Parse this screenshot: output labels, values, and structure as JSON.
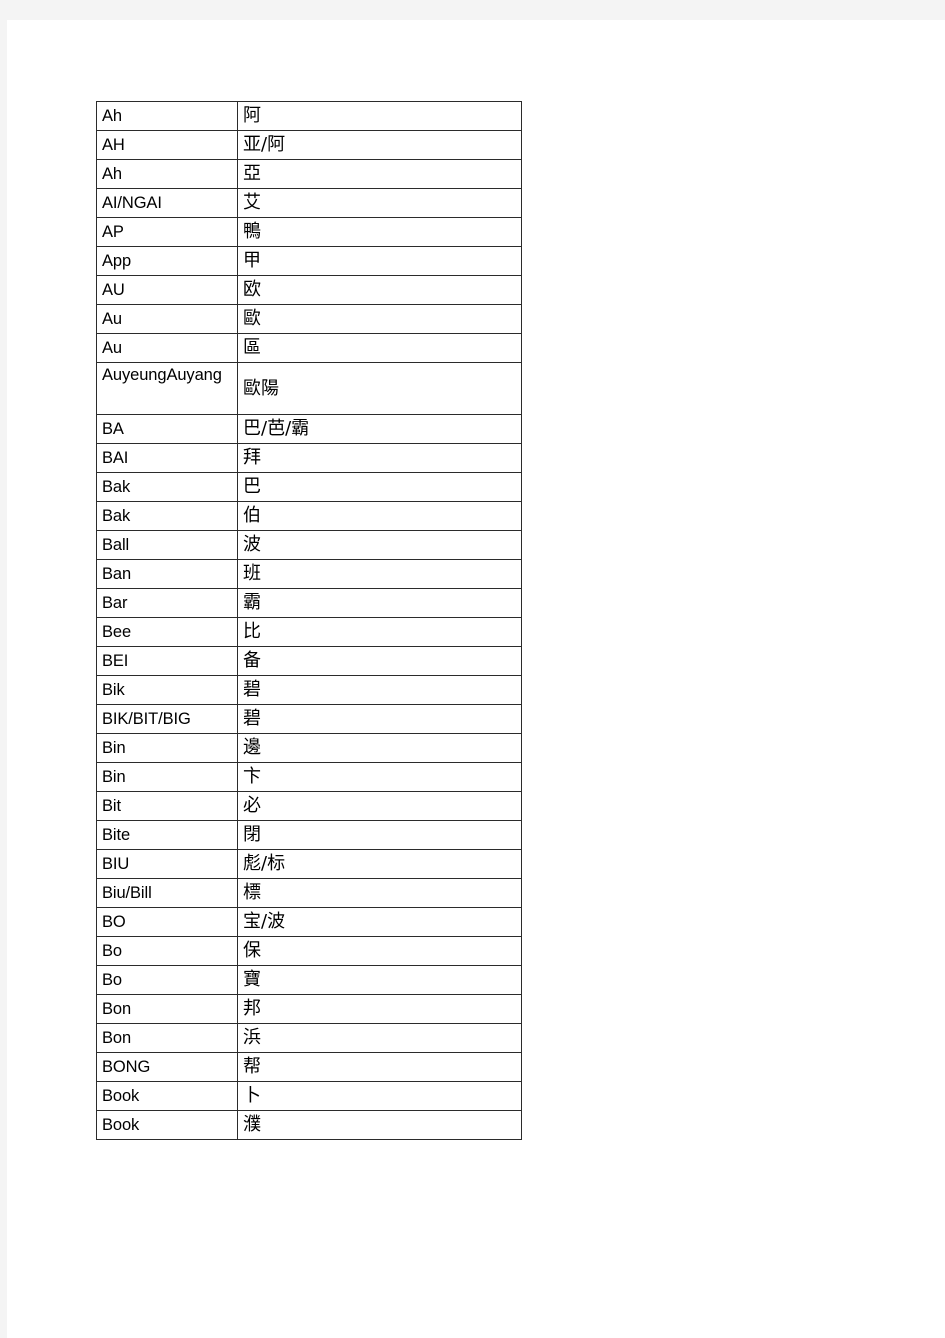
{
  "document": {
    "page_background": "#ffffff",
    "canvas_background": "#f4f4f4",
    "border_color": "#2b2b2b"
  },
  "table": {
    "name": "cantonese-romanization-table",
    "column_count": 2,
    "row_count": 35,
    "rows": [
      {
        "roman": "Ah",
        "hanzi": "阿"
      },
      {
        "roman": "AH",
        "hanzi": "亚/阿"
      },
      {
        "roman": "Ah",
        "hanzi": "亞"
      },
      {
        "roman": "AI/NGAI",
        "hanzi": "艾"
      },
      {
        "roman": "AP",
        "hanzi": "鴨"
      },
      {
        "roman": "App",
        "hanzi": "甲"
      },
      {
        "roman": "AU",
        "hanzi": "欧"
      },
      {
        "roman": "Au",
        "hanzi": "歐"
      },
      {
        "roman": "Au",
        "hanzi": "區"
      },
      {
        "roman": "AuyeungAuyang",
        "hanzi": "歐陽",
        "tall": true
      },
      {
        "roman": "BA",
        "hanzi": "巴/芭/霸"
      },
      {
        "roman": "BAI",
        "hanzi": "拜"
      },
      {
        "roman": "Bak",
        "hanzi": "巴"
      },
      {
        "roman": "Bak",
        "hanzi": "伯"
      },
      {
        "roman": "Ball",
        "hanzi": "波"
      },
      {
        "roman": "Ban",
        "hanzi": "班"
      },
      {
        "roman": "Bar",
        "hanzi": "霸"
      },
      {
        "roman": "Bee",
        "hanzi": "比"
      },
      {
        "roman": "BEI",
        "hanzi": "备"
      },
      {
        "roman": "Bik",
        "hanzi": "碧"
      },
      {
        "roman": "BIK/BIT/BIG",
        "hanzi": "碧"
      },
      {
        "roman": "Bin",
        "hanzi": "邊"
      },
      {
        "roman": "Bin",
        "hanzi": "卞"
      },
      {
        "roman": "Bit",
        "hanzi": "必"
      },
      {
        "roman": "Bite",
        "hanzi": "閉"
      },
      {
        "roman": "BIU",
        "hanzi": "彪/标"
      },
      {
        "roman": "Biu/Bill",
        "hanzi": "標"
      },
      {
        "roman": "BO",
        "hanzi": "宝/波"
      },
      {
        "roman": "Bo",
        "hanzi": "保"
      },
      {
        "roman": "Bo",
        "hanzi": "寶"
      },
      {
        "roman": "Bon",
        "hanzi": "邦"
      },
      {
        "roman": "Bon",
        "hanzi": "浜"
      },
      {
        "roman": "BONG",
        "hanzi": "帮"
      },
      {
        "roman": "Book",
        "hanzi": "卜"
      },
      {
        "roman": "Book",
        "hanzi": "濮"
      }
    ]
  }
}
